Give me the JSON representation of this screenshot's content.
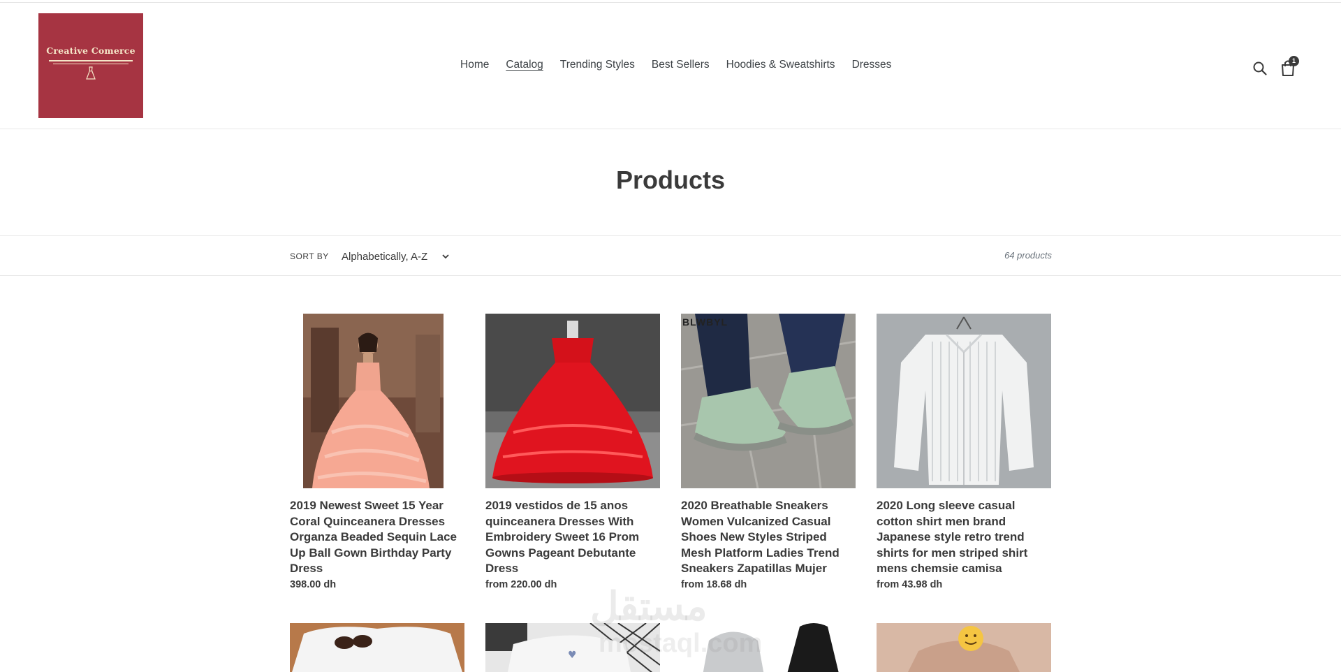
{
  "header": {
    "logo_text": "Creative Comerce",
    "nav": [
      {
        "label": "Home"
      },
      {
        "label": "Catalog"
      },
      {
        "label": "Trending Styles"
      },
      {
        "label": "Best Sellers"
      },
      {
        "label": "Hoodies & Sweatshirts"
      },
      {
        "label": "Dresses"
      }
    ],
    "active_nav": "Catalog",
    "cart_count": "1"
  },
  "page": {
    "title": "Products"
  },
  "filter": {
    "sort_label": "SORT BY",
    "sort_value": "Alphabetically, A-Z",
    "product_count": "64 products"
  },
  "products": [
    {
      "title": "2019 Newest Sweet 15 Year Coral Quinceanera Dresses Organza Beaded Sequin Lace Up Ball Gown Birthday Party Dress",
      "price": "398.00 dh"
    },
    {
      "title": "2019 vestidos de 15 anos quinceanera Dresses With Embroidery Sweet 16 Prom Gowns Pageant Debutante Dress",
      "price": "from 220.00 dh"
    },
    {
      "title": "2020 Breathable Sneakers Women Vulcanized Casual Shoes New Styles Striped Mesh Platform Ladies Trend Sneakers Zapatillas Mujer",
      "price": "from 18.68 dh"
    },
    {
      "title": "2020 Long sleeve casual cotton shirt men brand Japanese style retro trend shirts for men striped shirt mens chemsie camisa",
      "price": "from 43.98 dh"
    }
  ],
  "product_image_brand": "BLWBYL",
  "watermark": {
    "main": "مستقل",
    "sub": "mostaql.com"
  },
  "colors": {
    "brand": "#a63442",
    "logo_text": "#f5e6c8",
    "text": "#3a3a3a"
  }
}
